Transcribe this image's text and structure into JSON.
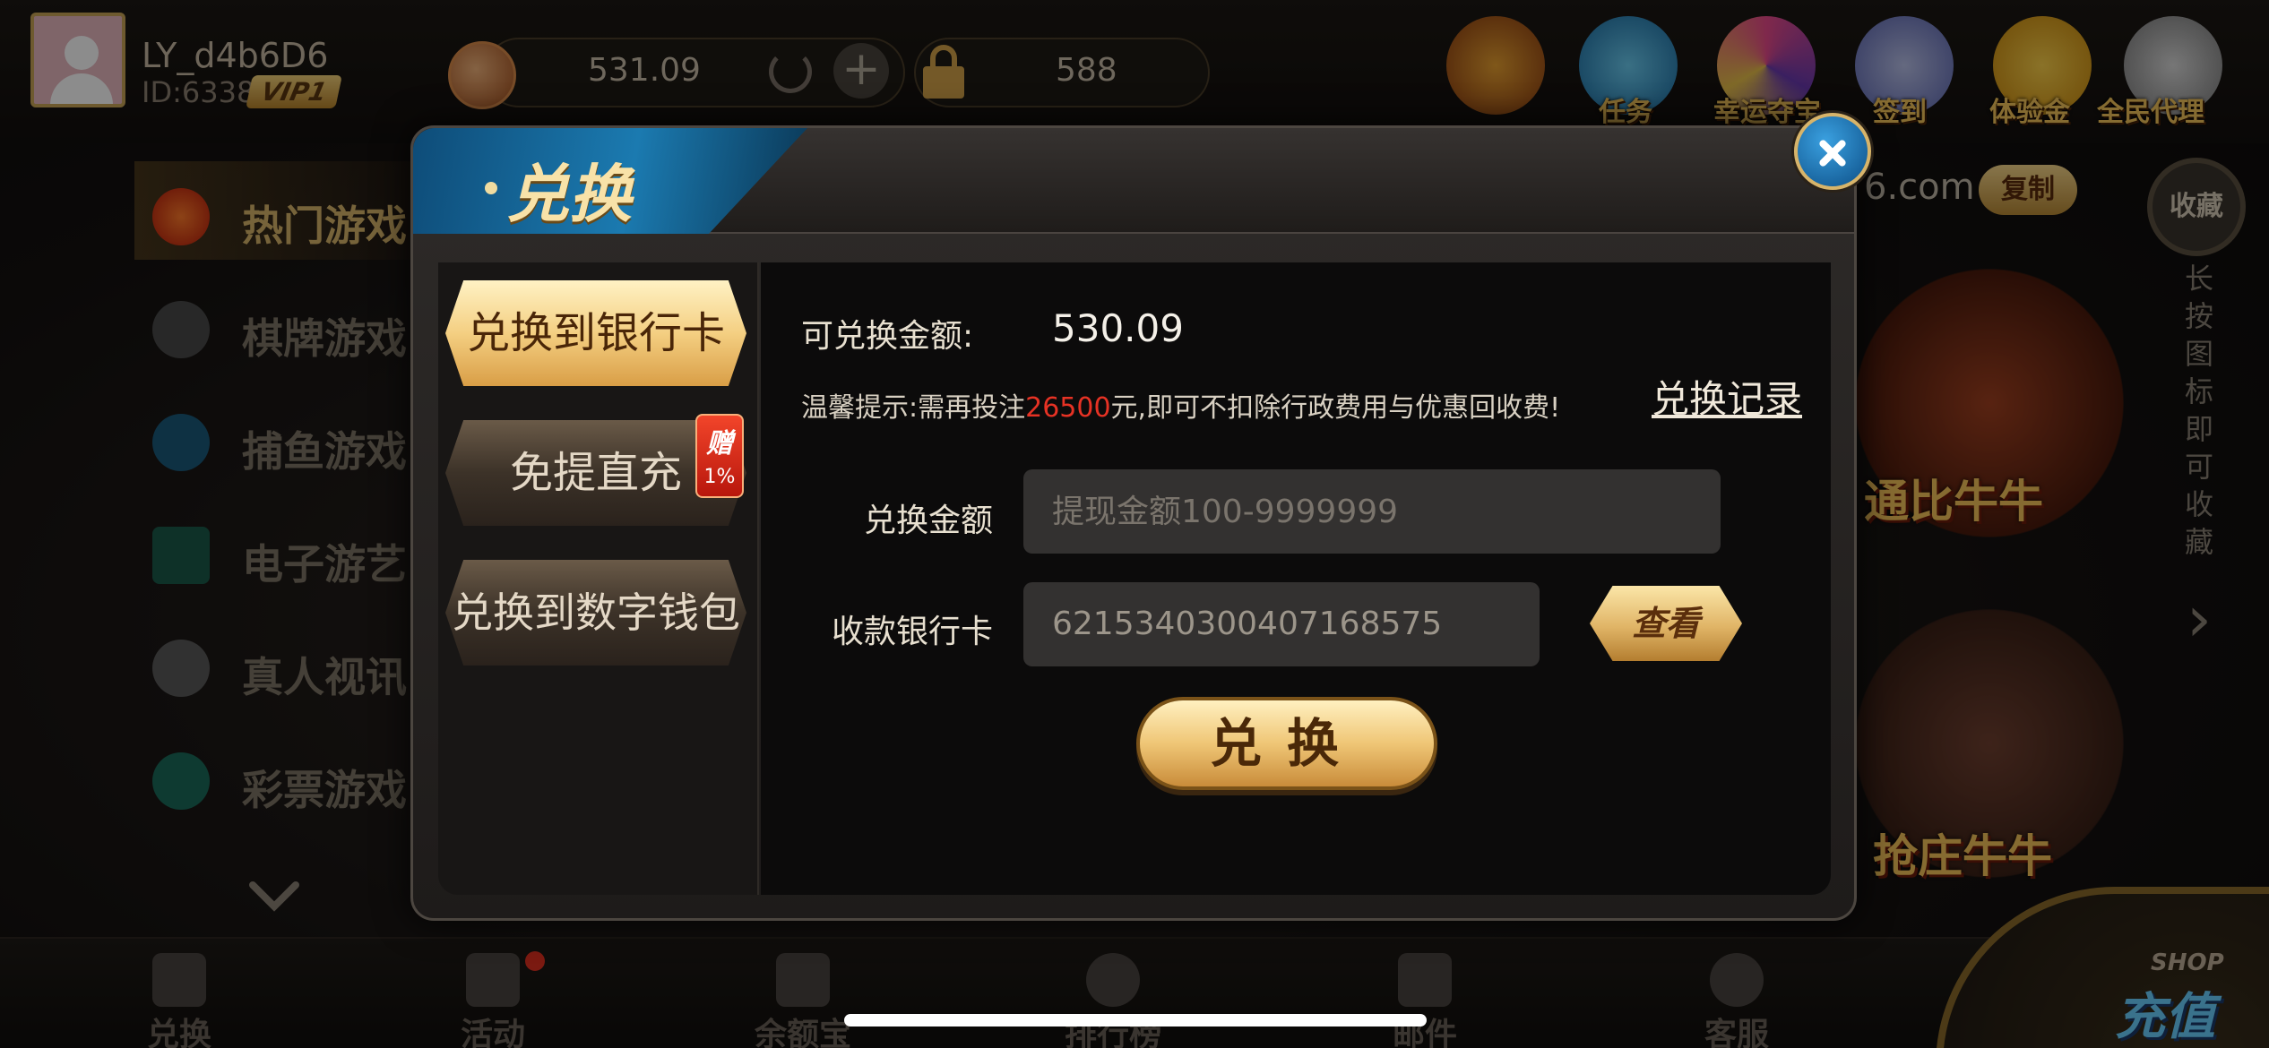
{
  "user": {
    "name": "LY_d4b6D6",
    "id": "ID:6338",
    "vip": "VIP1"
  },
  "wallet": {
    "balance": "531.09",
    "locked": "588"
  },
  "top_icons": [
    {
      "label": "",
      "icon": "money-bag-icon"
    },
    {
      "label": "任务",
      "icon": "gift-box-icon"
    },
    {
      "label": "幸运夺宝",
      "icon": "wheel-icon"
    },
    {
      "label": "签到",
      "icon": "calendar-icon"
    },
    {
      "label": "体验金",
      "icon": "yuan-coin-icon"
    },
    {
      "label": "全民代理",
      "icon": "megaphone-icon"
    }
  ],
  "left_menu": [
    {
      "label": "热门游戏",
      "icon": "fire-icon",
      "active": true
    },
    {
      "label": "棋牌游戏",
      "icon": "spade-icon",
      "active": false
    },
    {
      "label": "捕鱼游戏",
      "icon": "shark-icon",
      "active": false
    },
    {
      "label": "电子游艺",
      "icon": "slot-machine-icon",
      "active": false
    },
    {
      "label": "真人视讯",
      "icon": "roulette-icon",
      "active": false
    },
    {
      "label": "彩票游戏",
      "icon": "lottery-ball-icon",
      "active": false
    }
  ],
  "right": {
    "domain": "6.com",
    "copy_label": "复制",
    "fav_label": "收藏",
    "fav_hint": "长按图标即可收藏",
    "games": [
      {
        "label": "通比牛牛"
      },
      {
        "label": "抢庄牛牛"
      }
    ]
  },
  "bottom_nav": [
    {
      "label": "兑换"
    },
    {
      "label": "活动"
    },
    {
      "label": "余额宝"
    },
    {
      "label": "排行榜"
    },
    {
      "label": "邮件"
    },
    {
      "label": "客服"
    }
  ],
  "shop": {
    "tag": "SHOP",
    "label": "充值"
  },
  "dialog": {
    "title": "兑换",
    "side_tabs": [
      {
        "label": "兑换到银行卡",
        "active": true
      },
      {
        "label": "免提直充",
        "active": false
      },
      {
        "label": "兑换到数字钱包",
        "active": false
      }
    ],
    "gift_badge": {
      "text": "赠",
      "percent": "1%"
    },
    "available_label": "可兑换金额:",
    "available_amount": "530.09",
    "tip_prefix": "温馨提示:需再投注",
    "tip_amount": "26500",
    "tip_suffix": "元,即可不扣除行政费用与优惠回收费!",
    "record_link": "兑换记录",
    "amount_label": "兑换金额",
    "amount_placeholder": "提现金额100-9999999",
    "card_label": "收款银行卡",
    "card_value": "6215340300407168575",
    "view_label": "查看",
    "submit_label": "兑换"
  }
}
